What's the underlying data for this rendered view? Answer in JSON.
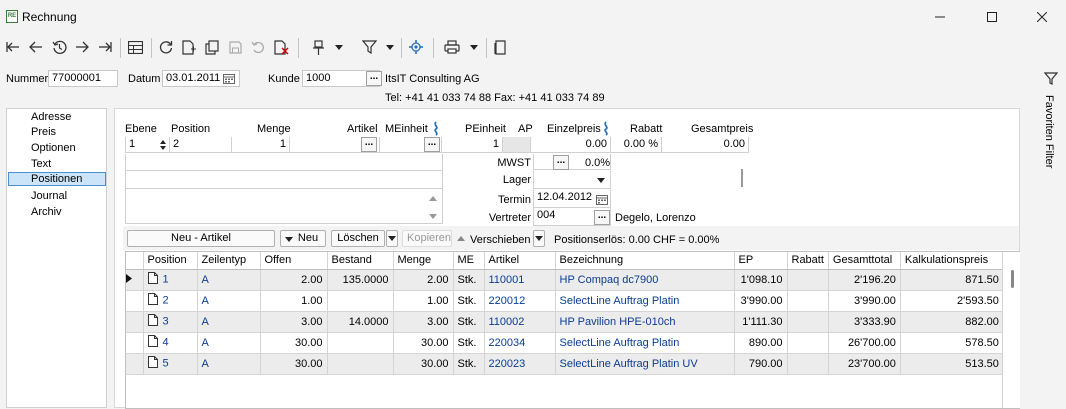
{
  "window": {
    "title": "Rechnung",
    "app_badge": "RE"
  },
  "toolbar": {
    "icons": [
      "first-icon",
      "previous-icon",
      "history-icon",
      "next-icon",
      "last-icon",
      "table-view-icon",
      "refresh-icon",
      "new-document-icon",
      "copy-icon",
      "save-icon",
      "undo-icon",
      "delete-icon",
      "pin-icon",
      "filter-icon",
      "settings-icon",
      "print-icon",
      "book-icon"
    ]
  },
  "header": {
    "nummer_label": "Nummer",
    "nummer_value": "77000001",
    "datum_label": "Datum",
    "datum_value": "03.01.2011",
    "kunde_label": "Kunde",
    "kunde_value": "1000",
    "kunde_name": "ItsIT Consulting AG",
    "kunde_contact": "Tel: +41 41 033 74 88   Fax: +41 41 033 74 89",
    "dots": "..."
  },
  "sidebar": {
    "items": [
      "Adresse",
      "Preis",
      "Optionen",
      "Text",
      "Positionen",
      "Journal",
      "Archiv"
    ],
    "selected": "Positionen"
  },
  "right_panel": {
    "label": "Favoriten Filter"
  },
  "entry": {
    "labels": {
      "ebene": "Ebene",
      "position": "Position",
      "menge": "Menge",
      "artikel": "Artikel",
      "meinheit": "MEinheit",
      "peinheit": "PEinheit",
      "ap": "AP",
      "einzelpreis": "Einzelpreis",
      "rabatt": "Rabatt",
      "gesamtpreis": "Gesamtpreis",
      "mwst": "MWST",
      "lager": "Lager",
      "termin": "Termin",
      "vertreter": "Vertreter"
    },
    "values": {
      "ebene": "1",
      "position": "2",
      "menge": "1",
      "peinheit": "1",
      "einzelpreis": "0.00",
      "rabatt": "0.00 %",
      "gesamtpreis": "0.00",
      "mwst": "0.0%",
      "termin": "12.04.2012",
      "vertreter": "004",
      "vertreter_name": "Degelo, Lorenzo"
    }
  },
  "actions": {
    "neu_artikel": "Neu - Artikel",
    "neu": "Neu",
    "loeschen": "Löschen",
    "kopieren": "Kopieren",
    "verschieben": "Verschieben",
    "positionserloes": "Positionserlös:  0.00 CHF = 0.00%"
  },
  "grid": {
    "columns": [
      "Position",
      "Zeilentyp",
      "Offen",
      "Bestand",
      "Menge",
      "ME",
      "Artikel",
      "Bezeichnung",
      "EP",
      "Rabatt",
      "Gesamttotal",
      "Kalkulationspreis"
    ],
    "rows": [
      {
        "position": "1",
        "zeilentyp": "A",
        "offen": "2.00",
        "bestand": "135.0000",
        "menge": "2.00",
        "me": "Stk.",
        "artikel": "110001",
        "bezeichnung": "HP Compaq dc7900",
        "ep": "1'098.10",
        "rabatt": "",
        "gesamttotal": "2'196.20",
        "kalk": "871.50"
      },
      {
        "position": "2",
        "zeilentyp": "A",
        "offen": "1.00",
        "bestand": "",
        "menge": "1.00",
        "me": "Stk.",
        "artikel": "220012",
        "bezeichnung": "SelectLine Auftrag Platin",
        "ep": "3'990.00",
        "rabatt": "",
        "gesamttotal": "3'990.00",
        "kalk": "2'593.50"
      },
      {
        "position": "3",
        "zeilentyp": "A",
        "offen": "3.00",
        "bestand": "14.0000",
        "menge": "3.00",
        "me": "Stk.",
        "artikel": "110002",
        "bezeichnung": "HP Pavilion HPE-010ch",
        "ep": "1'111.30",
        "rabatt": "",
        "gesamttotal": "3'333.90",
        "kalk": "882.00"
      },
      {
        "position": "4",
        "zeilentyp": "A",
        "offen": "30.00",
        "bestand": "",
        "menge": "30.00",
        "me": "Stk.",
        "artikel": "220034",
        "bezeichnung": "SelectLine Auftrag Platin",
        "ep": "890.00",
        "rabatt": "",
        "gesamttotal": "26'700.00",
        "kalk": "578.50"
      },
      {
        "position": "5",
        "zeilentyp": "A",
        "offen": "30.00",
        "bestand": "",
        "menge": "30.00",
        "me": "Stk.",
        "artikel": "220023",
        "bezeichnung": "SelectLine Auftrag Platin UV",
        "ep": "790.00",
        "rabatt": "",
        "gesamttotal": "23'700.00",
        "kalk": "513.50"
      }
    ]
  },
  "colors": {
    "accent": "#4a90d9",
    "selected_bg": "#cce4f7",
    "link_text": "#0b3d91"
  }
}
